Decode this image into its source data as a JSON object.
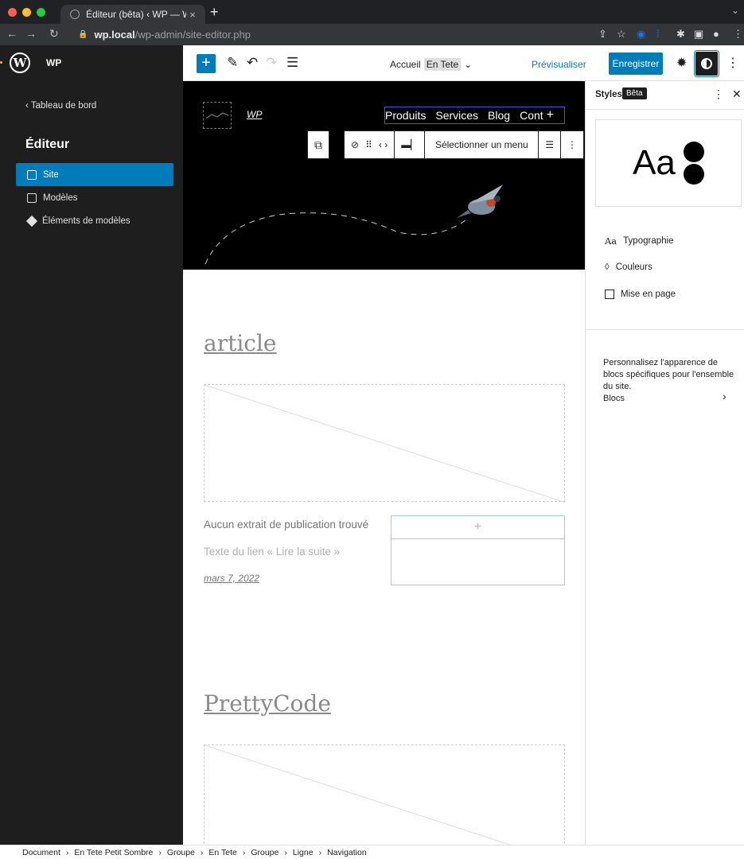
{
  "browser": {
    "tab_title": "Éditeur (bêta) ‹ WP — WordPress",
    "tab_close": "×",
    "new_tab": "+",
    "url_domain": "wp.local",
    "url_path": "/wp-admin/site-editor.php"
  },
  "header": {
    "site_name": "WP",
    "doc_title": "Accueil",
    "doc_template": "En Tete",
    "preview_label": "Prévisualiser",
    "save_label": "Enregistrer"
  },
  "sidebar": {
    "back_label": "Tableau de bord",
    "title": "Éditeur",
    "items": [
      {
        "label": "Site"
      },
      {
        "label": "Modèles"
      },
      {
        "label": "Éléments de modèles"
      }
    ]
  },
  "canvas": {
    "hero_site_title": "WP",
    "nav_items": [
      "Produits",
      "Services",
      "Blog",
      "Cont"
    ],
    "nav_add": "+",
    "toolbar_select_menu": "Sélectionner un menu",
    "post_title_1": "article",
    "excerpt": "Aucun extrait de publication trouvé",
    "read_more": "Texte du lien « Lire la suite »",
    "date": "mars 7, 2022",
    "sidebox_add": "+",
    "post_title_2": "PrettyCode"
  },
  "styles_panel": {
    "title": "Styles",
    "badge": "Bêta",
    "preview_text": "Aa",
    "items": [
      {
        "icon": "Aa",
        "label": "Typographie"
      },
      {
        "label": "Couleurs"
      },
      {
        "label": "Mise en page"
      }
    ],
    "description": "Personnalisez l'apparence de blocs spécifiques pour l'ensemble du site.",
    "blocks_label": "Blocs"
  },
  "breadcrumb": [
    "Document",
    "En Tete Petit Sombre",
    "Groupe",
    "En Tete",
    "Groupe",
    "Ligne",
    "Navigation"
  ],
  "colors": {
    "accent": "#007cba",
    "dark": "#1e1e1e",
    "selection": "#3858e9"
  }
}
